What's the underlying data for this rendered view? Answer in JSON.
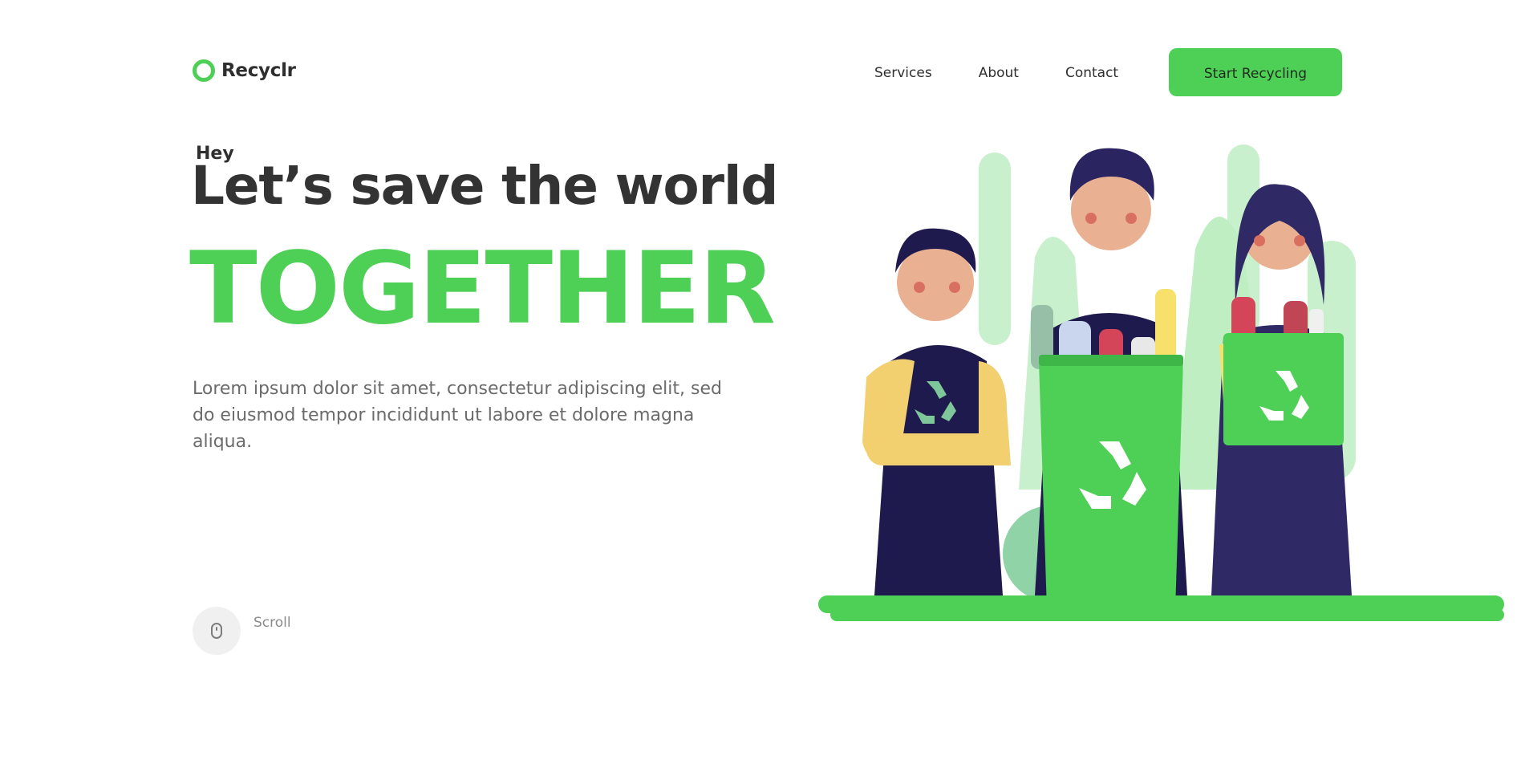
{
  "brand": {
    "name": "Recyclr",
    "accent_color": "#4ecf55"
  },
  "nav": {
    "items": [
      {
        "label": "Services"
      },
      {
        "label": "About"
      },
      {
        "label": "Contact"
      }
    ],
    "cta_label": "Start Recycling"
  },
  "hero": {
    "greeting": "Hey",
    "headline": "Let’s save the world",
    "emphasis": "TOGETHER",
    "lead": "Lorem ipsum dolor sit amet, consectetur adipiscing elit, sed do eiusmod tempor incididunt ut labore et dolore magna aliqua."
  },
  "scroll": {
    "label": "Scroll",
    "icon": "mouse-icon"
  },
  "illustration": {
    "subject": "three people holding recycling bins",
    "icon": "recycle-icon"
  }
}
